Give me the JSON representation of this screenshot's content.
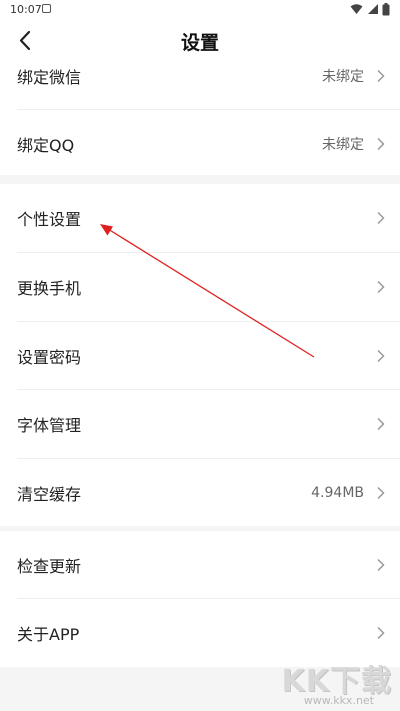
{
  "status_bar": {
    "time": "10:07"
  },
  "header": {
    "title": "设置"
  },
  "group1": {
    "items": [
      {
        "label": "绑定微信",
        "value": "未绑定"
      },
      {
        "label": "绑定QQ",
        "value": "未绑定"
      }
    ]
  },
  "group2": {
    "items": [
      {
        "label": "个性设置"
      },
      {
        "label": "更换手机"
      },
      {
        "label": "设置密码"
      },
      {
        "label": "字体管理"
      },
      {
        "label": "清空缓存",
        "value": "4.94MB"
      }
    ]
  },
  "group3": {
    "items": [
      {
        "label": "检查更新"
      },
      {
        "label": "关于APP"
      }
    ]
  },
  "annotation": {
    "color": "#e02020"
  },
  "watermark": {
    "logo": "KK下载",
    "url": "www.kkx.net"
  }
}
